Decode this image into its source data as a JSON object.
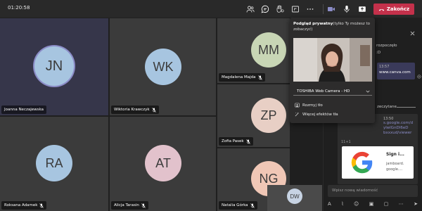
{
  "topbar": {
    "timer": "01:20:58",
    "leave_label": "Zakończ",
    "icons": [
      "people-icon",
      "chat-icon",
      "reactions-icon",
      "share-tray-icon",
      "more-icon",
      "camera-icon",
      "mic-icon",
      "share-icon",
      "phone-hangup-icon"
    ]
  },
  "participants": [
    {
      "initials": "JN",
      "name": "Joanna Neczajewska",
      "color": "#a7c5e0"
    },
    {
      "initials": "WK",
      "name": "Wiktoria Krawczyk",
      "color": "#a7c5e0"
    },
    {
      "initials": "MM",
      "name": "Magdalena Majda",
      "color": "#c8d6b5"
    },
    {
      "initials": "ZP",
      "name": "Zofia Pasek",
      "color": "#e8cfc5"
    },
    {
      "initials": "RA",
      "name": "Roksana Adamek",
      "color": "#a7c5e0"
    },
    {
      "initials": "AT",
      "name": "Alicja Tarasin",
      "color": "#e2c2cc"
    },
    {
      "initials": "NG",
      "name": "Natalia Górka",
      "color": "#f0c7b6"
    },
    {
      "initials": "DW",
      "name": "",
      "color": "#c7d3e3"
    }
  ],
  "popup": {
    "title_bold": "Podgląd prywatny",
    "title_rest": "(tylko Ty możesz to zobaczyć)",
    "camera": "TOSHIBA Web Camera - HD",
    "blur": "Rozmyj tło",
    "effects": "Więcej efektów tła"
  },
  "chat": {
    "line_partial": "rozpoczęło",
    "msg1_time": "13:57",
    "msg1_text": "www.canva.com",
    "divider_partial": "zeczytane",
    "msg2_time": "13:50",
    "msg2_lines": [
      "s.google.com/d",
      "ylwlGnDl6eD",
      "bxxxud/viewer"
    ],
    "msg2_tag": "11+1",
    "card_title": "Sign i...",
    "card_sub1": "jamboard.",
    "card_sub2": "google....",
    "compose_placeholder": "Wpisz nową wiadomość"
  },
  "colors": {
    "leave": "#c4314b",
    "accent": "#6264a7",
    "tile": "#3b3b3b"
  }
}
